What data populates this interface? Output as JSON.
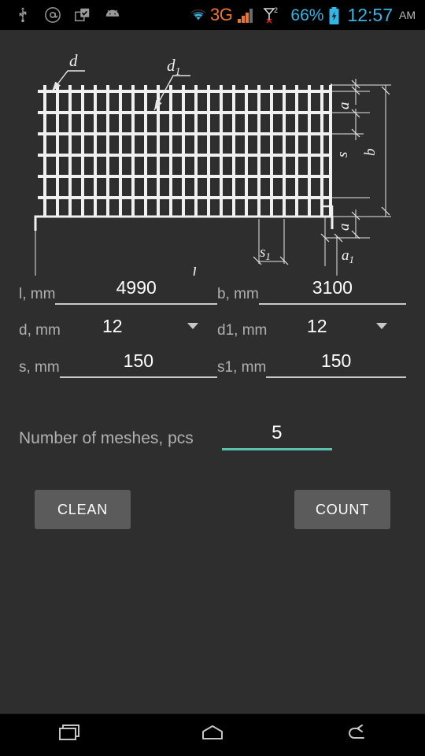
{
  "statusbar": {
    "icons": [
      "usb-icon",
      "email-icon",
      "clipboard-check-icon",
      "android-icon"
    ],
    "network_type": "3G",
    "wifi": "wifi-icon",
    "signal": "signal-bars-icon",
    "sim": "sim-no-signal-icon",
    "sim_badge": "2",
    "battery_percent": "66%",
    "battery": "battery-charging-icon",
    "time": "12:57",
    "ampm": "AM"
  },
  "diagram": {
    "name": "reinforcement-mesh-diagram",
    "labels": {
      "d": "d",
      "d1_base": "d",
      "d1_sub": "1",
      "a_top": "a",
      "s_right": "s",
      "b": "b",
      "a_bottom": "a",
      "a1_base": "a",
      "a1_sub": "1",
      "s1_base": "s",
      "s1_sub": "1",
      "l": "l"
    },
    "grid": {
      "vertical_bars": 24,
      "horizontal_bars": 8
    }
  },
  "form": {
    "length": {
      "label": "l, mm",
      "value": "4990"
    },
    "width": {
      "label": "b, mm",
      "value": "3100"
    },
    "d": {
      "label": "d, mm",
      "value": "12"
    },
    "d1": {
      "label": "d1, mm",
      "value": "12"
    },
    "s": {
      "label": "s, mm",
      "value": "150"
    },
    "s1": {
      "label": "s1, mm",
      "value": "150"
    },
    "meshes": {
      "label": "Number of meshes, pcs",
      "value": "5"
    }
  },
  "buttons": {
    "clean": "CLEAN",
    "count": "COUNT"
  },
  "navbar": {
    "recents": "recents-icon",
    "home": "home-icon",
    "back": "back-icon"
  },
  "colors": {
    "background": "#2e2e2e",
    "accent": "#5cc0ae",
    "status_blue": "#33b5e5",
    "status_orange": "#e8762c",
    "button": "#5b5b5b"
  }
}
